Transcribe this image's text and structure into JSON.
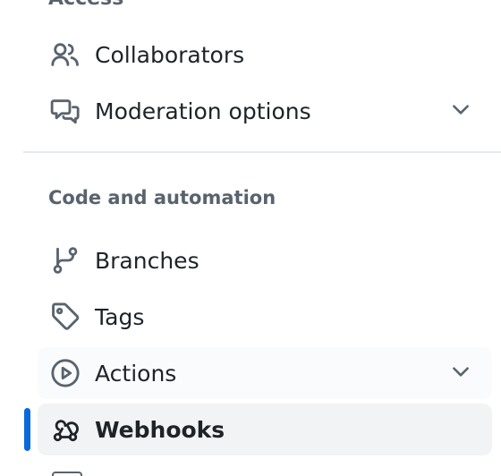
{
  "sidebar": {
    "access_heading": "Access",
    "items_access": [
      {
        "label": "Collaborators",
        "icon": "people-icon"
      },
      {
        "label": "Moderation options",
        "icon": "comment-discussion-icon",
        "expandable": true
      }
    ],
    "section_heading": "Code and automation",
    "items_code": [
      {
        "label": "Branches",
        "icon": "git-branch-icon"
      },
      {
        "label": "Tags",
        "icon": "tag-icon"
      },
      {
        "label": "Actions",
        "icon": "play-icon",
        "expandable": true
      },
      {
        "label": "Webhooks",
        "icon": "webhook-icon",
        "active": true
      }
    ],
    "active_color": "#0969da"
  }
}
